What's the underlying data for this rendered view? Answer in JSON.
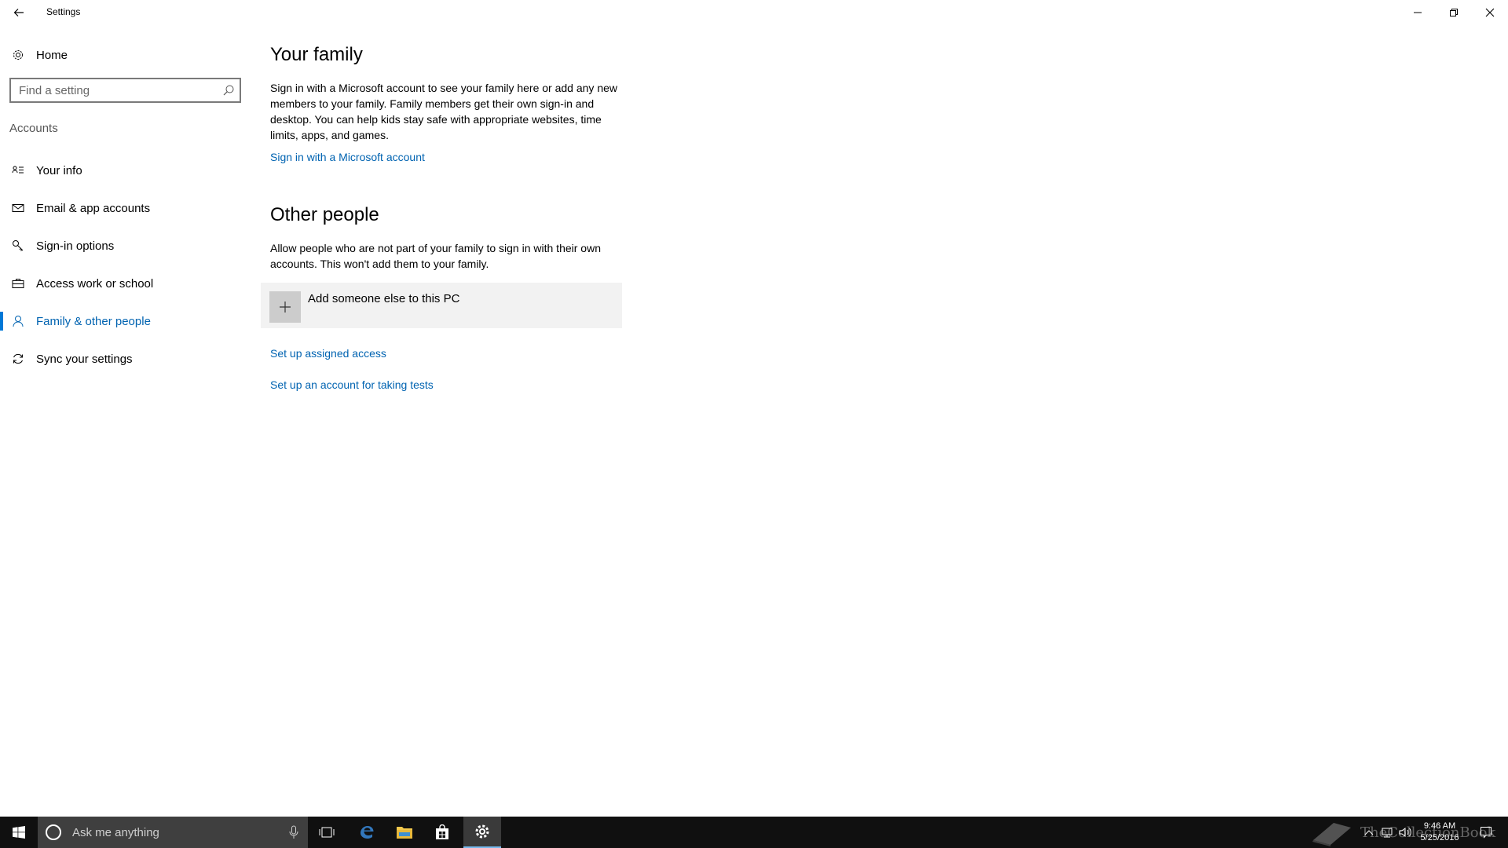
{
  "window": {
    "title": "Settings",
    "controls": [
      "minimize-icon",
      "restore-icon",
      "close-icon"
    ]
  },
  "sidebar": {
    "home_label": "Home",
    "search_placeholder": "Find a setting",
    "section_label": "Accounts",
    "items": [
      {
        "label": "Your info",
        "icon": "person-card-icon",
        "active": false
      },
      {
        "label": "Email & app accounts",
        "icon": "mail-icon",
        "active": false
      },
      {
        "label": "Sign-in options",
        "icon": "key-icon",
        "active": false
      },
      {
        "label": "Access work or school",
        "icon": "briefcase-icon",
        "active": false
      },
      {
        "label": "Family & other people",
        "icon": "person-icon",
        "active": true
      },
      {
        "label": "Sync your settings",
        "icon": "sync-icon",
        "active": false
      }
    ]
  },
  "main": {
    "family": {
      "heading": "Your family",
      "description": "Sign in with a Microsoft account to see your family here or add any new members to your family. Family members get their own sign-in and desktop. You can help kids stay safe with appropriate websites, time limits, apps, and games.",
      "link": "Sign in with a Microsoft account"
    },
    "other": {
      "heading": "Other people",
      "description": "Allow people who are not part of your family to sign in with their own accounts. This won't add them to your family.",
      "add_label": "Add someone else to this PC",
      "link_assigned": "Set up assigned access",
      "link_tests": "Set up an account for taking tests"
    }
  },
  "taskbar": {
    "search_placeholder": "Ask me anything",
    "clock_time": "9:46 AM",
    "clock_date": "5/25/2016",
    "watermark": "TheCollectionBook",
    "accent": "#0078d7"
  }
}
